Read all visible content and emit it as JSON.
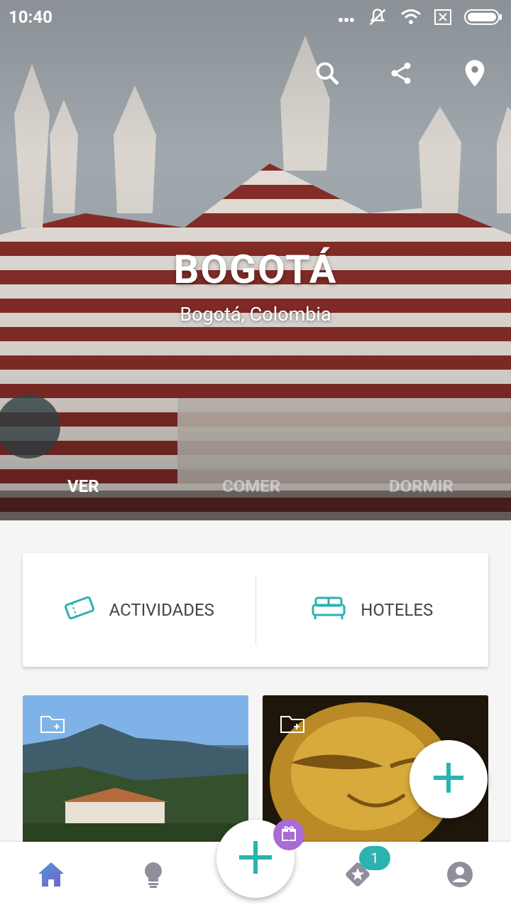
{
  "status_bar": {
    "time": "10:40"
  },
  "hero": {
    "title": "BOGOTÁ",
    "subtitle": "Bogotá, Colombia"
  },
  "tabs": [
    {
      "label": "VER",
      "active": true
    },
    {
      "label": "COMER",
      "active": false
    },
    {
      "label": "DORMIR",
      "active": false
    }
  ],
  "quick_actions": [
    {
      "label": "ACTIVIDADES",
      "icon": "ticket-icon"
    },
    {
      "label": "HOTELES",
      "icon": "bed-icon"
    }
  ],
  "bottom_nav": {
    "favorites_badge": "1"
  },
  "colors": {
    "accent": "#2ab3b0",
    "gift": "#a96bd6",
    "nav_icon": "#8f8f9c"
  }
}
